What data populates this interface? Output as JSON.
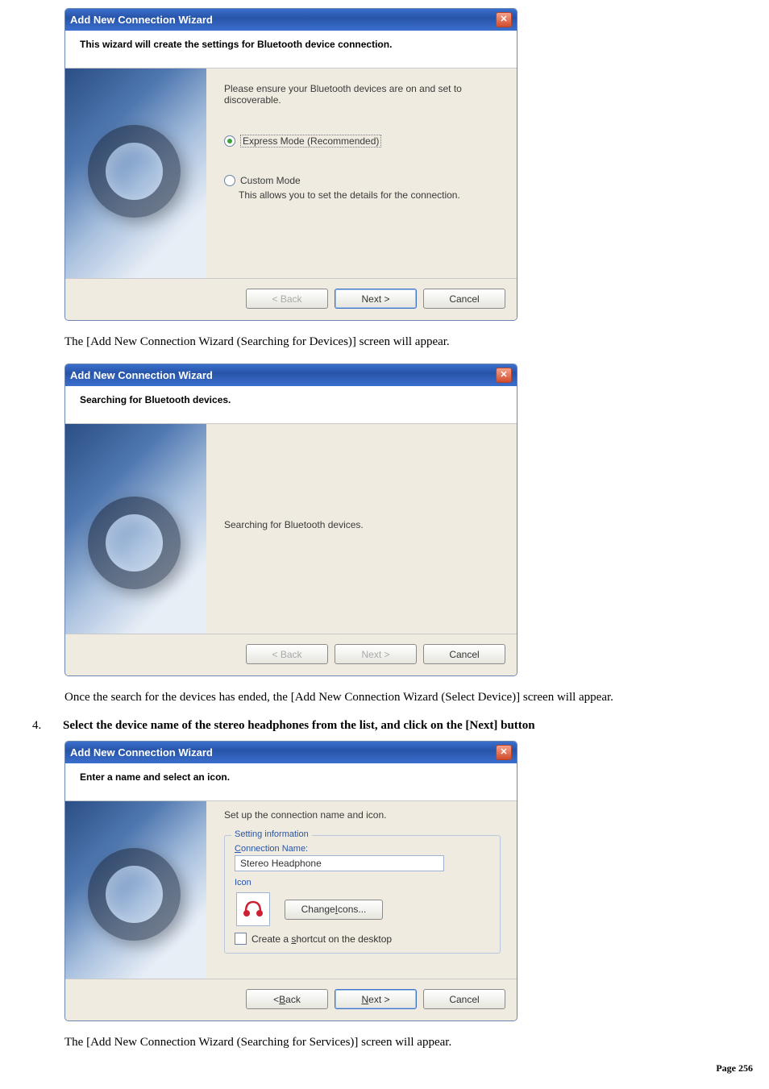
{
  "wizard1": {
    "title": "Add New Connection Wizard",
    "header": "This wizard will create the settings for Bluetooth device connection.",
    "instruction": "Please ensure your Bluetooth devices are on and set to discoverable.",
    "opt_express": "Express Mode (Recommended)",
    "opt_custom": "Custom Mode",
    "custom_desc": "This allows you to set the details for the connection.",
    "btn_back": "< Back",
    "btn_next": "Next >",
    "btn_cancel": "Cancel"
  },
  "caption1": "The [Add New Connection Wizard (Searching for Devices)] screen will appear.",
  "wizard2": {
    "title": "Add New Connection Wizard",
    "header": "Searching for Bluetooth devices.",
    "status": "Searching for Bluetooth devices.",
    "btn_back": "< Back",
    "btn_next": "Next >",
    "btn_cancel": "Cancel"
  },
  "caption2": "Once the search for the devices has ended, the [Add New Connection Wizard (Select Device)] screen will appear.",
  "step4_num": "4.",
  "step4_text": "Select the device name of the stereo headphones from the list, and click on the [Next] button",
  "wizard3": {
    "title": "Add New Connection Wizard",
    "header": "Enter a name and select an icon.",
    "instruction": "Set up the connection name and icon.",
    "legend": "Setting information",
    "conn_name_label": "Connection Name:",
    "conn_name_value": "Stereo Headphone",
    "icon_label": "Icon",
    "btn_change_icons": "Change Icons...",
    "chk_shortcut": "Create a shortcut on the desktop",
    "btn_back_pre": "< ",
    "btn_back_u": "B",
    "btn_back_post": "ack",
    "btn_next_u": "N",
    "btn_next_post": "ext >",
    "btn_cancel": "Cancel"
  },
  "caption3": "The [Add New Connection Wizard (Searching for Services)] screen will appear.",
  "page_label": "Page 256"
}
